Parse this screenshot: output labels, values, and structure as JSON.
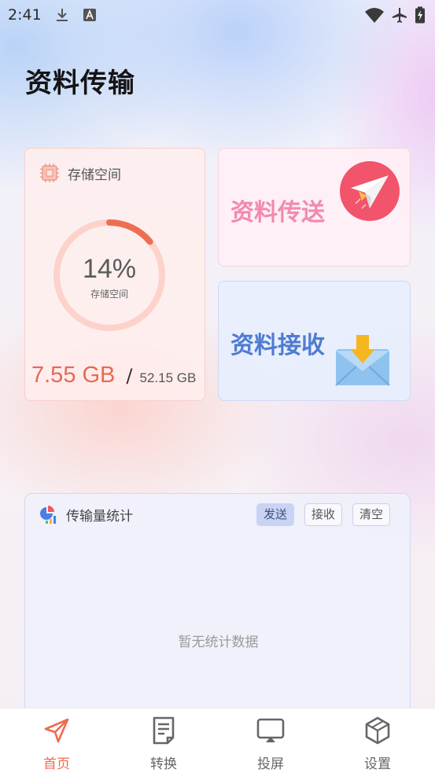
{
  "status_bar": {
    "time": "2:41",
    "icons": [
      "download-icon",
      "font-app-icon",
      "wifi-icon",
      "airplane-mode-icon",
      "battery-charging-icon"
    ]
  },
  "header": {
    "title": "资料传输"
  },
  "storage": {
    "label": "存储空间",
    "percent_text": "14%",
    "percent_value": 14,
    "ring_caption": "存储空间",
    "used": "7.55 GB",
    "separator": "/",
    "total": "52.15 GB",
    "accent_color": "#ee6e52",
    "track_color": "#fcd2cb"
  },
  "actions": {
    "send_label": "资料传送",
    "receive_label": "资料接收"
  },
  "stats": {
    "title": "传输量统计",
    "filters": [
      {
        "label": "发送",
        "active": true
      },
      {
        "label": "接收",
        "active": false
      },
      {
        "label": "清空",
        "active": false
      }
    ],
    "empty_text": "暂无统计数据"
  },
  "bottom_nav": {
    "items": [
      {
        "label": "首页",
        "icon": "send-arrow-icon",
        "active": true
      },
      {
        "label": "转换",
        "icon": "document-icon",
        "active": false
      },
      {
        "label": "投屏",
        "icon": "screen-cast-icon",
        "active": false
      },
      {
        "label": "设置",
        "icon": "cube-settings-icon",
        "active": false
      }
    ],
    "active_color": "#ef6a50"
  }
}
